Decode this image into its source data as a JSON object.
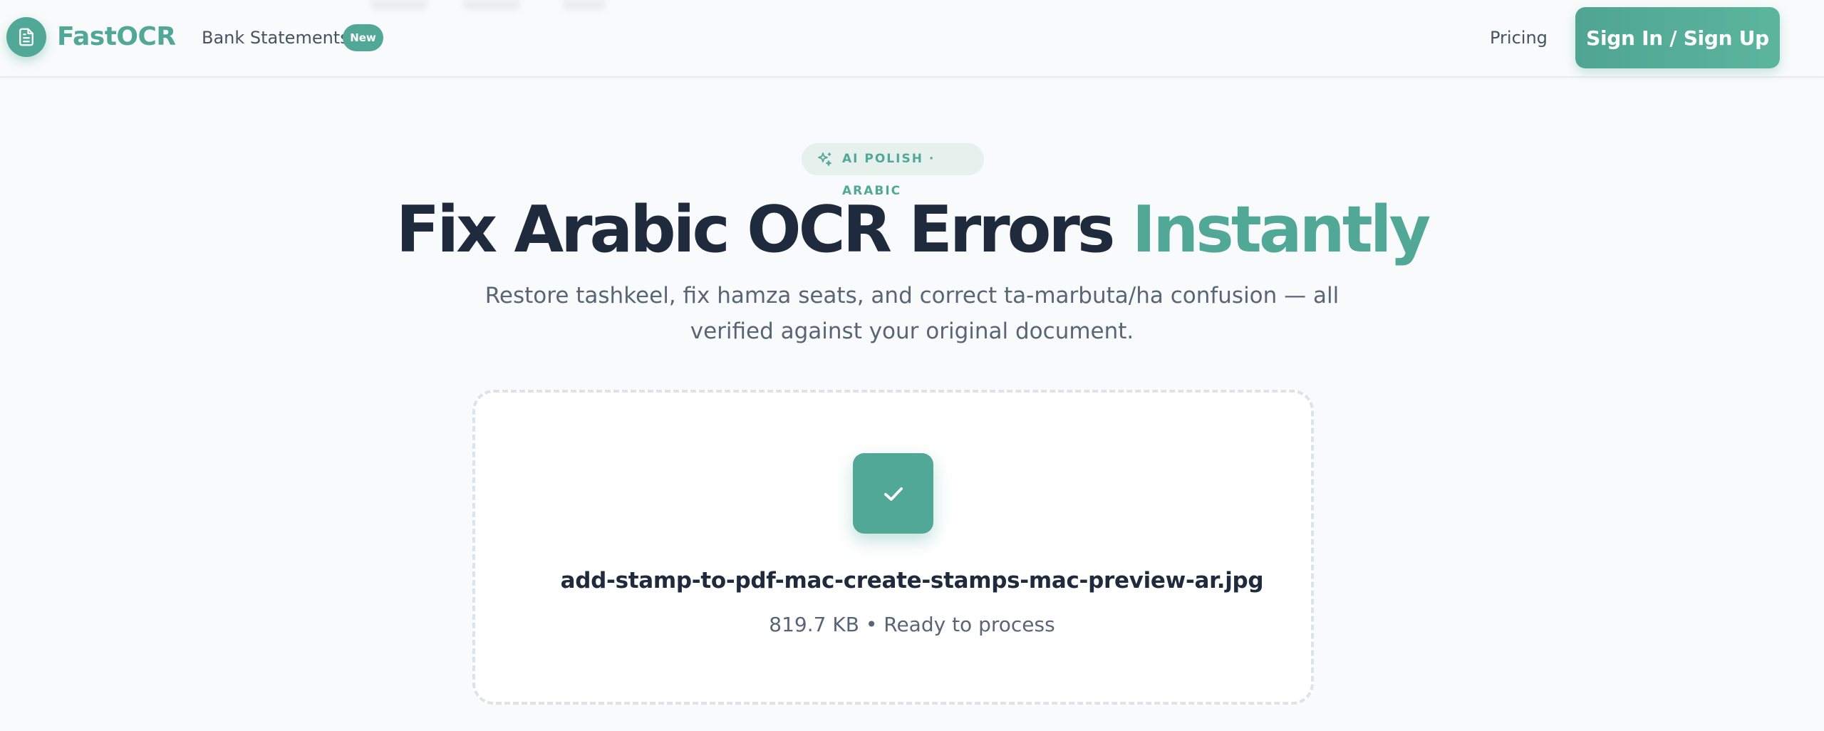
{
  "header": {
    "brand": "FastOCR",
    "nav": {
      "bank_statements": "Bank Statements",
      "new_badge": "New",
      "pricing": "Pricing"
    },
    "auth_button": "Sign In / Sign Up"
  },
  "hero": {
    "pill": "AI POLISH · ARABIC",
    "title_main": "Fix Arabic OCR Errors ",
    "title_accent": "Instantly",
    "subtitle": "Restore tashkeel, fix hamza seats, and correct ta-marbuta/ha confusion — all verified against your original document."
  },
  "upload": {
    "file_name": "add-stamp-to-pdf-mac-create-stamps-mac-preview-ar.jpg",
    "file_meta": "819.7 KB • Ready to process",
    "icon": "check-icon"
  },
  "colors": {
    "brand": "#52a896",
    "heading": "#1f2a3c",
    "muted": "#596576"
  }
}
